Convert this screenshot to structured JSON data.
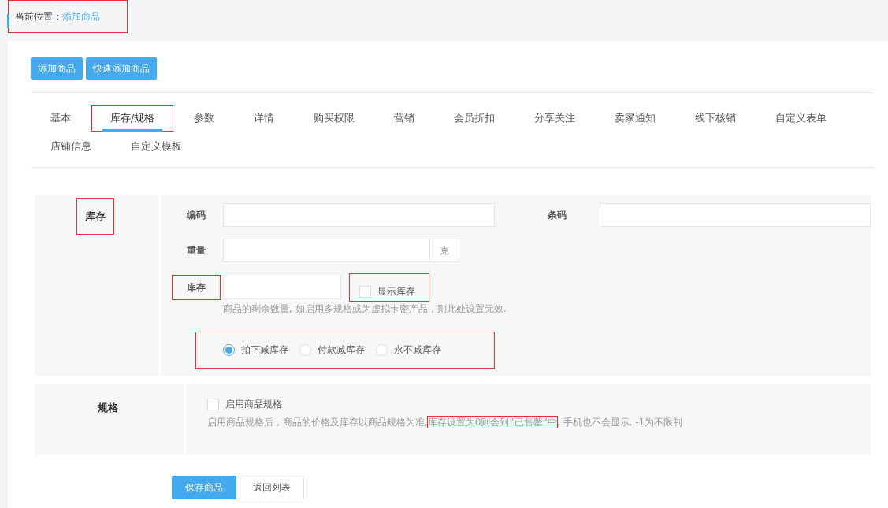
{
  "breadcrumb": {
    "label": "当前位置：",
    "current": "添加商品",
    "highlighted": true
  },
  "top_buttons": [
    {
      "label": "添加商品"
    },
    {
      "label": "快速添加商品"
    }
  ],
  "tabs": [
    {
      "label": "基本",
      "selected": false,
      "highlighted": false
    },
    {
      "label": "库存/规格",
      "selected": true,
      "highlighted": true
    },
    {
      "label": "参数",
      "selected": false,
      "highlighted": false
    },
    {
      "label": "详情",
      "selected": false,
      "highlighted": false
    },
    {
      "label": "购买权限",
      "selected": false,
      "highlighted": false
    },
    {
      "label": "营销",
      "selected": false,
      "highlighted": false
    },
    {
      "label": "会员折扣",
      "selected": false,
      "highlighted": false
    },
    {
      "label": "分享关注",
      "selected": false,
      "highlighted": false
    },
    {
      "label": "卖家通知",
      "selected": false,
      "highlighted": false
    },
    {
      "label": "线下核销",
      "selected": false,
      "highlighted": false
    },
    {
      "label": "自定义表单",
      "selected": false,
      "highlighted": false
    },
    {
      "label": "店铺信息",
      "selected": false,
      "highlighted": false
    },
    {
      "label": "自定义模板",
      "selected": false,
      "highlighted": false
    }
  ],
  "stock_section": {
    "title": "库存",
    "title_highlighted": true,
    "code_label": "编码",
    "barcode_label": "条码",
    "weight_label": "重量",
    "weight_unit": "克",
    "stock_label": "库存",
    "stock_label_highlighted": true,
    "show_stock": {
      "label": "显示库存",
      "checked": false,
      "highlighted": true
    },
    "stock_hint": "商品的剩余数量, 如启用多规格或为虚拟卡密产品，则此处设置无效.",
    "deduct_options_highlighted": true,
    "deduct_options": [
      {
        "label": "拍下减库存",
        "selected": true
      },
      {
        "label": "付款减库存",
        "selected": false
      },
      {
        "label": "永不减库存",
        "selected": false
      }
    ]
  },
  "spec_section": {
    "title": "规格",
    "enable_spec": {
      "label": "启用商品规格",
      "checked": false
    },
    "hint": [
      {
        "text": "启用商品规格后，商品的价格及库存以商品规格为准,",
        "highlighted": false
      },
      {
        "text": "库存设置为0则会到”已售罄“中",
        "highlighted": true
      },
      {
        "text": ", 手机也不会显示, -1为不限制",
        "highlighted": false
      }
    ]
  },
  "bottom_buttons": [
    {
      "label": "保存商品",
      "kind": "primary"
    },
    {
      "label": "返回列表",
      "kind": "default"
    }
  ]
}
